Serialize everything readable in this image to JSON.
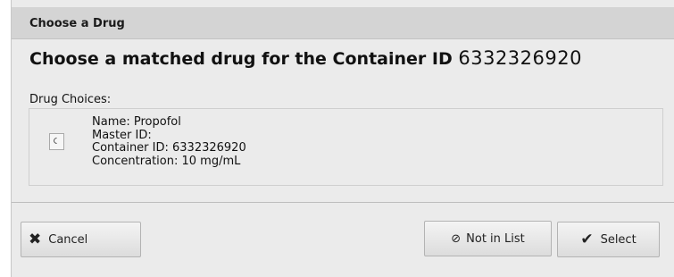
{
  "dialog": {
    "title": "Choose a Drug",
    "heading_text": "Choose a matched drug for the Container ID",
    "heading_container_id": "6332326920"
  },
  "choices": {
    "label": "Drug Choices:",
    "items": [
      {
        "selected": false,
        "name_line": "Name: Propofol",
        "master_id_line": "Master ID:",
        "container_id_line": "Container ID: 6332326920",
        "concentration_line": "Concentration: 10 mg/mL"
      }
    ]
  },
  "buttons": {
    "cancel": {
      "label": "Cancel",
      "icon": "close-icon"
    },
    "not_in_list": {
      "label": "Not in List",
      "icon": "prohibited-icon"
    },
    "select": {
      "label": "Select",
      "icon": "checkmark-icon"
    }
  }
}
